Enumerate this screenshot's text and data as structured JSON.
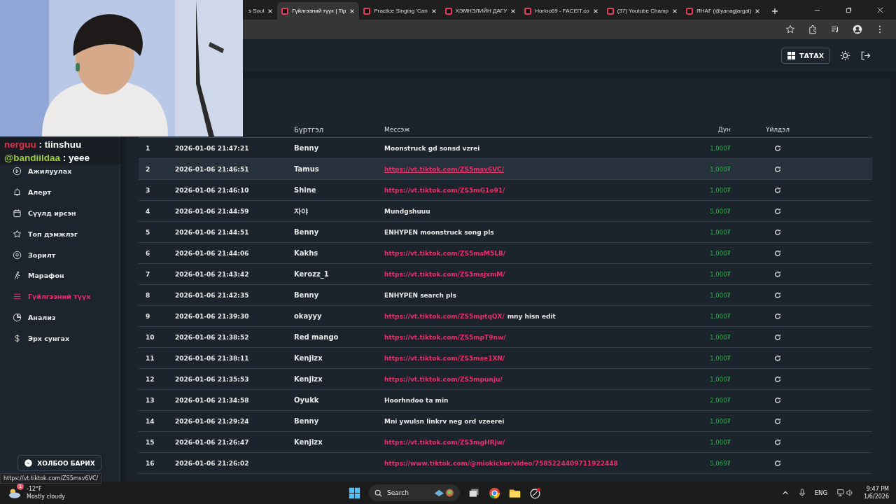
{
  "browser": {
    "tabs": [
      {
        "title": "s Soul",
        "selected": false
      },
      {
        "title": "Гүйлгээний түүх | Tip",
        "selected": true
      },
      {
        "title": "Practice Singing 'Can",
        "selected": false
      },
      {
        "title": "ХЭМНЭЛИЙН ДАГУ",
        "selected": false
      },
      {
        "title": "Horloo69 - FACEIT.co",
        "selected": false
      },
      {
        "title": "(37) Youtube Champ",
        "selected": false
      },
      {
        "title": "ЯНАГ (@yanagjargal)",
        "selected": false
      }
    ]
  },
  "header": {
    "download_button": "ТАТАХ"
  },
  "chat_overlay": [
    {
      "user": "nerguu",
      "color": "#e0304a",
      "message": ": tiinshuu"
    },
    {
      "user": "@bandiildaa",
      "color": "#9ccc3a",
      "message": ": yeee"
    }
  ],
  "sidebar": {
    "items": [
      {
        "label": "Ажилуулах",
        "selected": false
      },
      {
        "label": "Алерт",
        "selected": false
      },
      {
        "label": "Сүүлд ирсэн",
        "selected": false
      },
      {
        "label": "Топ дэмжлэг",
        "selected": false
      },
      {
        "label": "Зорилт",
        "selected": false
      },
      {
        "label": "Марафон",
        "selected": false
      },
      {
        "label": "Гүйлгээний түүх",
        "selected": true
      },
      {
        "label": "Анализ",
        "selected": false
      },
      {
        "label": "Эрх сунгах",
        "selected": false
      }
    ],
    "contact_button": "ХОЛБОО БАРИХ"
  },
  "table": {
    "columns": [
      "Бүртгэл",
      "Мессэж",
      "Дүн",
      "Үйлдэл"
    ],
    "rows": [
      {
        "no": "1",
        "date": "2026-01-06 21:47:21",
        "user": "Benny",
        "message": [
          {
            "kind": "text",
            "text": "Moonstruck gd sonsd vzrei"
          }
        ],
        "amount": "1,000₮",
        "selected": false
      },
      {
        "no": "2",
        "date": "2026-01-06 21:46:51",
        "user": "Tamus",
        "message": [
          {
            "kind": "link",
            "text": "https://vt.tiktok.com/ZS5msv6VC/"
          }
        ],
        "amount": "1,000₮",
        "selected": true
      },
      {
        "no": "3",
        "date": "2026-01-06 21:46:10",
        "user": "Shine",
        "message": [
          {
            "kind": "link",
            "text": "https://vt.tiktok.com/ZS5mG1o91/"
          }
        ],
        "amount": "1,000₮",
        "selected": false
      },
      {
        "no": "4",
        "date": "2026-01-06 21:44:59",
        "user": "자야",
        "message": [
          {
            "kind": "text",
            "text": "Mundgshuuu"
          }
        ],
        "amount": "5,000₮",
        "selected": false
      },
      {
        "no": "5",
        "date": "2026-01-06 21:44:51",
        "user": "Benny",
        "message": [
          {
            "kind": "text",
            "text": "ENHYPEN moonstruck song pls"
          }
        ],
        "amount": "1,000₮",
        "selected": false
      },
      {
        "no": "6",
        "date": "2026-01-06 21:44:06",
        "user": "Kakhs",
        "message": [
          {
            "kind": "link",
            "text": "https://vt.tiktok.com/ZS5msM5LB/"
          }
        ],
        "amount": "1,000₮",
        "selected": false
      },
      {
        "no": "7",
        "date": "2026-01-06 21:43:42",
        "user": "Kerozz_1",
        "message": [
          {
            "kind": "link",
            "text": "https://vt.tiktok.com/ZS5msjxmM/"
          }
        ],
        "amount": "1,000₮",
        "selected": false
      },
      {
        "no": "8",
        "date": "2026-01-06 21:42:35",
        "user": "Benny",
        "message": [
          {
            "kind": "text",
            "text": "ENHYPEN search pls"
          }
        ],
        "amount": "1,000₮",
        "selected": false
      },
      {
        "no": "9",
        "date": "2026-01-06 21:39:30",
        "user": "okayyy",
        "message": [
          {
            "kind": "link",
            "text": "https://vt.tiktok.com/ZS5mptqQX/"
          },
          {
            "kind": "text",
            "text": "mny hisn edit"
          }
        ],
        "amount": "1,000₮",
        "selected": false
      },
      {
        "no": "10",
        "date": "2026-01-06 21:38:52",
        "user": "Red mango",
        "message": [
          {
            "kind": "link",
            "text": "https://vt.tiktok.com/ZS5mpT9nw/"
          }
        ],
        "amount": "1,000₮",
        "selected": false
      },
      {
        "no": "11",
        "date": "2026-01-06 21:38:11",
        "user": "Kenjizx",
        "message": [
          {
            "kind": "link",
            "text": "https://vt.tiktok.com/ZS5mse1XN/"
          }
        ],
        "amount": "1,000₮",
        "selected": false
      },
      {
        "no": "12",
        "date": "2026-01-06 21:35:53",
        "user": "Kenjizx",
        "message": [
          {
            "kind": "link",
            "text": "https://vt.tiktok.com/ZS5mpunju/"
          }
        ],
        "amount": "1,000₮",
        "selected": false
      },
      {
        "no": "13",
        "date": "2026-01-06 21:34:58",
        "user": "Oyukk",
        "message": [
          {
            "kind": "text",
            "text": "Hoorhndoo ta min"
          }
        ],
        "amount": "2,000₮",
        "selected": false
      },
      {
        "no": "14",
        "date": "2026-01-06 21:29:24",
        "user": "Benny",
        "message": [
          {
            "kind": "text",
            "text": "Mni ywulsn linkrv neg ord vzeerei"
          }
        ],
        "amount": "1,000₮",
        "selected": false
      },
      {
        "no": "15",
        "date": "2026-01-06 21:26:47",
        "user": "Kenjizx",
        "message": [
          {
            "kind": "link",
            "text": "https://vt.tiktok.com/ZS5mgHRjw/"
          }
        ],
        "amount": "1,000₮",
        "selected": false
      },
      {
        "no": "16",
        "date": "2026-01-06 21:26:02",
        "message": [
          {
            "kind": "link",
            "text": "https://www.tiktok.com/@miokicker/video/7585224409711922448"
          }
        ],
        "amount": "5,069₮",
        "selected": false
      }
    ]
  },
  "status_url": "https://vt.tiktok.com/ZS5msv6VC/",
  "taskbar": {
    "weather": {
      "temperature": "-12°F",
      "condition": "Mostly cloudy",
      "badge": "1"
    },
    "search": "Search",
    "language": "ENG",
    "time": "9:47 PM",
    "date": "1/6/2026"
  }
}
